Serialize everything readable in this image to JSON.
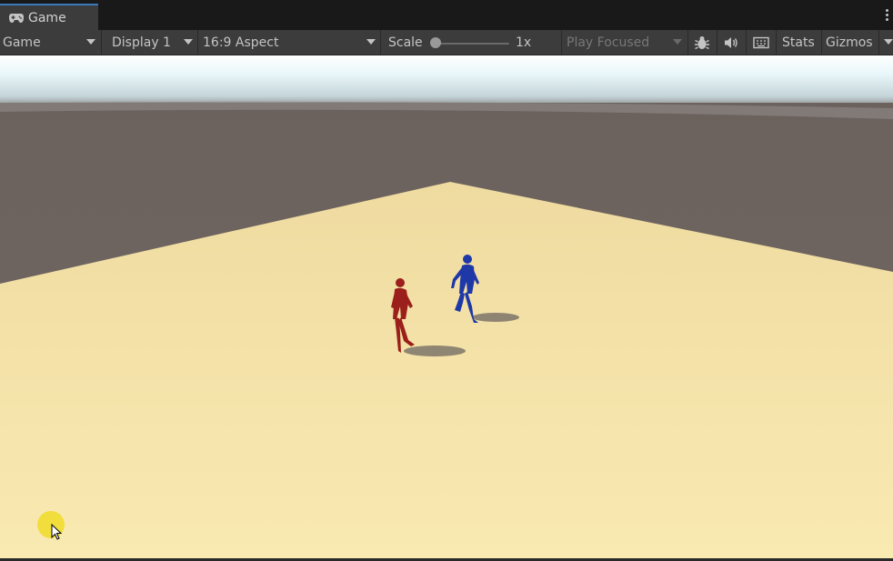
{
  "window": {
    "tab_title": "Game",
    "tab_icon": "gamepad-icon"
  },
  "toolbar": {
    "view_mode": "Game",
    "display": "Display 1",
    "aspect": "16:9 Aspect",
    "scale_label": "Scale",
    "scale_value": "1x",
    "scale_level": 0,
    "play_mode": "Play Focused",
    "stats_label": "Stats",
    "gizmos_label": "Gizmos",
    "icons": [
      "bug-icon",
      "speaker-icon",
      "keyboard-icon"
    ]
  },
  "scene": {
    "characters": [
      {
        "name": "red-character",
        "color": "#9b1f1a"
      },
      {
        "name": "blue-character",
        "color": "#1f38a8"
      }
    ],
    "ground_color": "#f3e2a6",
    "sky_color": "#e8f6f9",
    "backdrop_color": "#6a625e"
  },
  "colors": {
    "tab_accent": "#3a79bb",
    "cursor_highlight": "#f0dc28"
  }
}
